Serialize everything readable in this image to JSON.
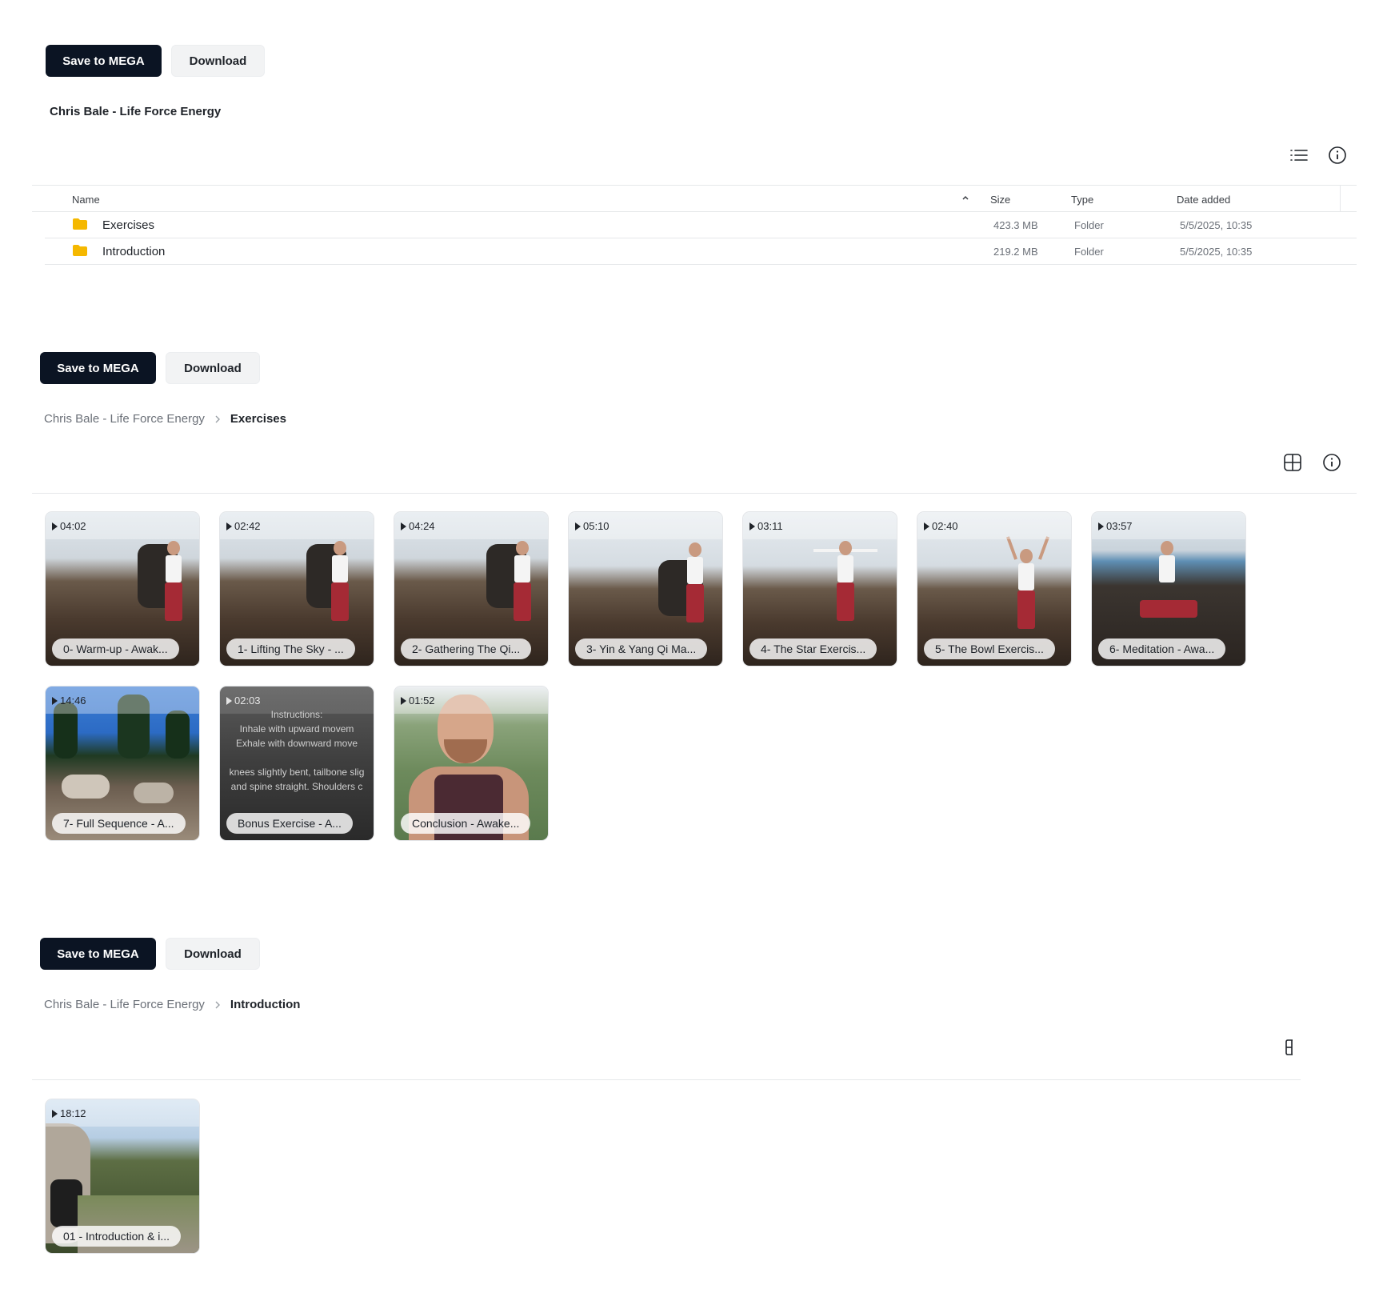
{
  "actions": {
    "save_label": "Save to MEGA",
    "download_label": "Download"
  },
  "panel1": {
    "title": "Chris Bale - Life Force Energy",
    "columns": {
      "name": "Name",
      "size": "Size",
      "type": "Type",
      "date": "Date added"
    },
    "rows": [
      {
        "name": "Exercises",
        "size": "423.3 MB",
        "type": "Folder",
        "date": "5/5/2025, 10:35"
      },
      {
        "name": "Introduction",
        "size": "219.2 MB",
        "type": "Folder",
        "date": "5/5/2025, 10:35"
      }
    ]
  },
  "panel2": {
    "breadcrumb_root": "Chris Bale - Life Force Energy",
    "breadcrumb_current": "Exercises",
    "videos": [
      {
        "duration": "04:02",
        "label": "0- Warm-up - Awak..."
      },
      {
        "duration": "02:42",
        "label": "1- Lifting The Sky - ..."
      },
      {
        "duration": "04:24",
        "label": "2- Gathering The Qi..."
      },
      {
        "duration": "05:10",
        "label": "3- Yin & Yang Qi Ma..."
      },
      {
        "duration": "03:11",
        "label": "4- The Star Exercis..."
      },
      {
        "duration": "02:40",
        "label": "5- The Bowl Exercis..."
      },
      {
        "duration": "03:57",
        "label": "6- Meditation - Awa..."
      },
      {
        "duration": "14:46",
        "label": "7- Full Sequence - A..."
      },
      {
        "duration": "02:03",
        "label": "Bonus Exercise - A..."
      },
      {
        "duration": "01:52",
        "label": "Conclusion - Awake..."
      }
    ],
    "bonus_overlay": [
      "Instructions:",
      "Inhale with upward movem",
      "Exhale with downward move",
      "knees slightly bent, tailbone slig",
      "and spine straight. Shoulders c"
    ]
  },
  "panel3": {
    "breadcrumb_root": "Chris Bale - Life Force Energy",
    "breadcrumb_current": "Introduction",
    "videos": [
      {
        "duration": "18:12",
        "label": "01 - Introduction & i..."
      }
    ]
  },
  "icons": [
    "list-view-icon",
    "info-icon",
    "grid-view-icon",
    "sort-asc-icon",
    "folder-icon",
    "play-icon",
    "chevron-right-icon"
  ],
  "colors": {
    "primary_button": "#0b1423",
    "folder": "#f5b800",
    "trousers": "#a52a35"
  }
}
